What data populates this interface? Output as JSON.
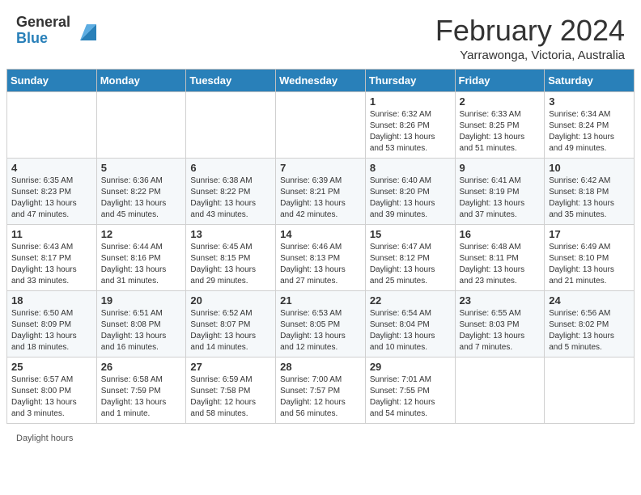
{
  "header": {
    "logo_general": "General",
    "logo_blue": "Blue",
    "month_title": "February 2024",
    "location": "Yarrawonga, Victoria, Australia"
  },
  "footer": {
    "daylight_label": "Daylight hours"
  },
  "weekdays": [
    "Sunday",
    "Monday",
    "Tuesday",
    "Wednesday",
    "Thursday",
    "Friday",
    "Saturday"
  ],
  "weeks": [
    [
      {
        "day": "",
        "detail": ""
      },
      {
        "day": "",
        "detail": ""
      },
      {
        "day": "",
        "detail": ""
      },
      {
        "day": "",
        "detail": ""
      },
      {
        "day": "1",
        "detail": "Sunrise: 6:32 AM\nSunset: 8:26 PM\nDaylight: 13 hours\nand 53 minutes."
      },
      {
        "day": "2",
        "detail": "Sunrise: 6:33 AM\nSunset: 8:25 PM\nDaylight: 13 hours\nand 51 minutes."
      },
      {
        "day": "3",
        "detail": "Sunrise: 6:34 AM\nSunset: 8:24 PM\nDaylight: 13 hours\nand 49 minutes."
      }
    ],
    [
      {
        "day": "4",
        "detail": "Sunrise: 6:35 AM\nSunset: 8:23 PM\nDaylight: 13 hours\nand 47 minutes."
      },
      {
        "day": "5",
        "detail": "Sunrise: 6:36 AM\nSunset: 8:22 PM\nDaylight: 13 hours\nand 45 minutes."
      },
      {
        "day": "6",
        "detail": "Sunrise: 6:38 AM\nSunset: 8:22 PM\nDaylight: 13 hours\nand 43 minutes."
      },
      {
        "day": "7",
        "detail": "Sunrise: 6:39 AM\nSunset: 8:21 PM\nDaylight: 13 hours\nand 42 minutes."
      },
      {
        "day": "8",
        "detail": "Sunrise: 6:40 AM\nSunset: 8:20 PM\nDaylight: 13 hours\nand 39 minutes."
      },
      {
        "day": "9",
        "detail": "Sunrise: 6:41 AM\nSunset: 8:19 PM\nDaylight: 13 hours\nand 37 minutes."
      },
      {
        "day": "10",
        "detail": "Sunrise: 6:42 AM\nSunset: 8:18 PM\nDaylight: 13 hours\nand 35 minutes."
      }
    ],
    [
      {
        "day": "11",
        "detail": "Sunrise: 6:43 AM\nSunset: 8:17 PM\nDaylight: 13 hours\nand 33 minutes."
      },
      {
        "day": "12",
        "detail": "Sunrise: 6:44 AM\nSunset: 8:16 PM\nDaylight: 13 hours\nand 31 minutes."
      },
      {
        "day": "13",
        "detail": "Sunrise: 6:45 AM\nSunset: 8:15 PM\nDaylight: 13 hours\nand 29 minutes."
      },
      {
        "day": "14",
        "detail": "Sunrise: 6:46 AM\nSunset: 8:13 PM\nDaylight: 13 hours\nand 27 minutes."
      },
      {
        "day": "15",
        "detail": "Sunrise: 6:47 AM\nSunset: 8:12 PM\nDaylight: 13 hours\nand 25 minutes."
      },
      {
        "day": "16",
        "detail": "Sunrise: 6:48 AM\nSunset: 8:11 PM\nDaylight: 13 hours\nand 23 minutes."
      },
      {
        "day": "17",
        "detail": "Sunrise: 6:49 AM\nSunset: 8:10 PM\nDaylight: 13 hours\nand 21 minutes."
      }
    ],
    [
      {
        "day": "18",
        "detail": "Sunrise: 6:50 AM\nSunset: 8:09 PM\nDaylight: 13 hours\nand 18 minutes."
      },
      {
        "day": "19",
        "detail": "Sunrise: 6:51 AM\nSunset: 8:08 PM\nDaylight: 13 hours\nand 16 minutes."
      },
      {
        "day": "20",
        "detail": "Sunrise: 6:52 AM\nSunset: 8:07 PM\nDaylight: 13 hours\nand 14 minutes."
      },
      {
        "day": "21",
        "detail": "Sunrise: 6:53 AM\nSunset: 8:05 PM\nDaylight: 13 hours\nand 12 minutes."
      },
      {
        "day": "22",
        "detail": "Sunrise: 6:54 AM\nSunset: 8:04 PM\nDaylight: 13 hours\nand 10 minutes."
      },
      {
        "day": "23",
        "detail": "Sunrise: 6:55 AM\nSunset: 8:03 PM\nDaylight: 13 hours\nand 7 minutes."
      },
      {
        "day": "24",
        "detail": "Sunrise: 6:56 AM\nSunset: 8:02 PM\nDaylight: 13 hours\nand 5 minutes."
      }
    ],
    [
      {
        "day": "25",
        "detail": "Sunrise: 6:57 AM\nSunset: 8:00 PM\nDaylight: 13 hours\nand 3 minutes."
      },
      {
        "day": "26",
        "detail": "Sunrise: 6:58 AM\nSunset: 7:59 PM\nDaylight: 13 hours\nand 1 minute."
      },
      {
        "day": "27",
        "detail": "Sunrise: 6:59 AM\nSunset: 7:58 PM\nDaylight: 12 hours\nand 58 minutes."
      },
      {
        "day": "28",
        "detail": "Sunrise: 7:00 AM\nSunset: 7:57 PM\nDaylight: 12 hours\nand 56 minutes."
      },
      {
        "day": "29",
        "detail": "Sunrise: 7:01 AM\nSunset: 7:55 PM\nDaylight: 12 hours\nand 54 minutes."
      },
      {
        "day": "",
        "detail": ""
      },
      {
        "day": "",
        "detail": ""
      }
    ]
  ]
}
